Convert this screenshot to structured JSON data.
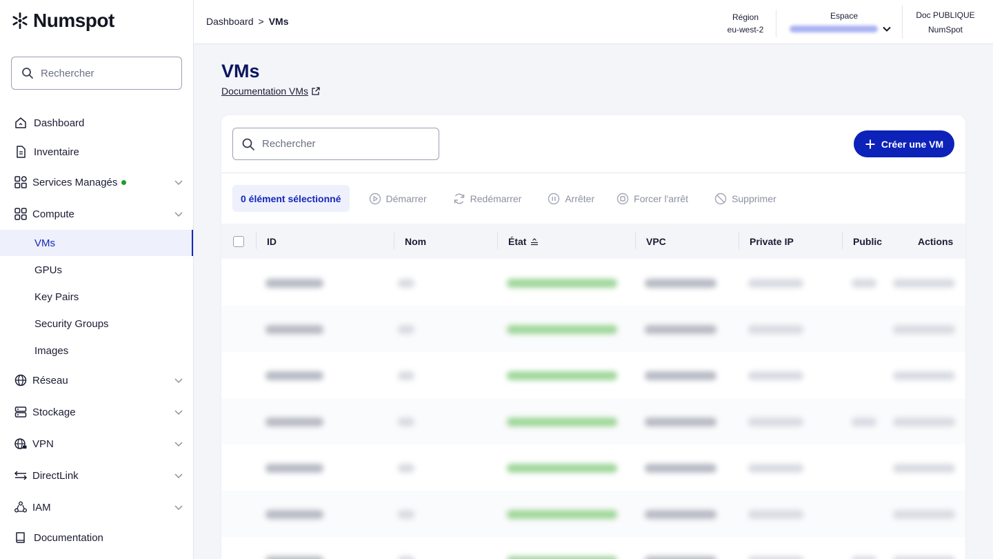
{
  "app": {
    "name": "Numspot"
  },
  "sidebar": {
    "search_placeholder": "Rechercher",
    "items": [
      {
        "label": "Dashboard",
        "icon": "home-icon"
      },
      {
        "label": "Inventaire",
        "icon": "document-icon"
      },
      {
        "label": "Services Managés",
        "icon": "apps-icon",
        "status": "green"
      },
      {
        "label": "Compute",
        "icon": "grid-icon"
      },
      {
        "label": "Réseau",
        "icon": "globe-icon"
      },
      {
        "label": "Stockage",
        "icon": "storage-icon"
      },
      {
        "label": "VPN",
        "icon": "globe-lock-icon"
      },
      {
        "label": "DirectLink",
        "icon": "arrows-icon"
      },
      {
        "label": "IAM",
        "icon": "users-icon"
      },
      {
        "label": "Documentation",
        "icon": "book-icon"
      }
    ],
    "compute_sub": [
      {
        "label": "VMs",
        "active": true
      },
      {
        "label": "GPUs"
      },
      {
        "label": "Key Pairs"
      },
      {
        "label": "Security Groups"
      },
      {
        "label": "Images"
      }
    ]
  },
  "topbar": {
    "breadcrumb_root": "Dashboard",
    "breadcrumb_sep": ">",
    "breadcrumb_current": "VMs",
    "region_label": "Région",
    "region_value": "eu-west-2",
    "space_label": "Espace",
    "org_label": "Doc PUBLIQUE",
    "org_value": "NumSpot"
  },
  "page": {
    "title": "VMs",
    "doc_link": "Documentation VMs",
    "search_placeholder": "Rechercher",
    "create_button": "Créer une VM",
    "selection": "0 élément sélectionné",
    "actions": [
      "Démarrer",
      "Redémarrer",
      "Arrêter",
      "Forcer l'arrêt",
      "Supprimer"
    ]
  },
  "table": {
    "columns": [
      "ID",
      "Nom",
      "État",
      "VPC",
      "Private IP",
      "Public",
      "Actions"
    ],
    "sorted_column": "État"
  },
  "colors": {
    "primary": "#0d22b8",
    "title": "#0b1560",
    "active_bg": "#eef0fc",
    "status_green": "#1c9e2a"
  }
}
